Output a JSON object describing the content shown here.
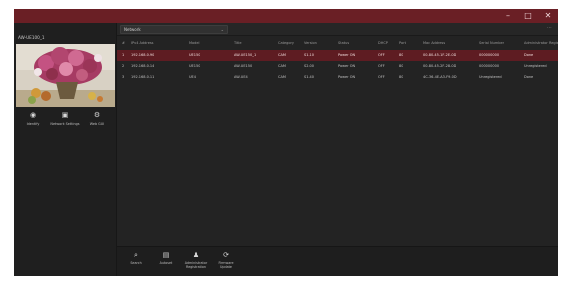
{
  "window": {
    "controls": {
      "minimize": "–",
      "maximize": "□",
      "close": "✕"
    }
  },
  "left_panel": {
    "device_name": "AW-UE100_1",
    "thumbnail": "flowers-camera-preview",
    "buttons": [
      {
        "label": "Identify",
        "icon": "identify-icon",
        "glyph": "◉"
      },
      {
        "label": "Network Settings",
        "icon": "network-settings-icon",
        "glyph": "▣"
      },
      {
        "label": "Web GUI",
        "icon": "web-gui-icon",
        "glyph": "⚙"
      }
    ]
  },
  "topbar": {
    "network_value": "Network",
    "chevron": "⌄",
    "more": "⋯"
  },
  "table": {
    "columns": [
      "#",
      "IPv4 Address",
      "Model",
      "Title",
      "Category",
      "Version",
      "Status",
      "DHCP",
      "Port",
      "Mac Address",
      "Serial Number",
      "Administrator Registration"
    ],
    "rows": [
      [
        "1",
        "192.168.0.90",
        "UE150",
        "AW-UE150_1",
        "CAM",
        "S1.10",
        "Power ON",
        "OFF",
        "80",
        "00-80-45-1F-2E-0D",
        "000000000",
        "Done"
      ],
      [
        "2",
        "192.168.0.14",
        "UE150",
        "AW-UE150",
        "CAM",
        "S2.00",
        "Power ON",
        "OFF",
        "80",
        "00-80-45-2F-28-0D",
        "000000000",
        "Unregistered"
      ],
      [
        "3",
        "192.168.0.11",
        "UE4",
        "AW-UE4",
        "CAM",
        "S1.40",
        "Power ON",
        "OFF",
        "80",
        "4C-36-4E-A3-F9-0D",
        "Unregistered",
        "Done"
      ]
    ]
  },
  "bottom_bar": {
    "buttons": [
      {
        "label": "Search",
        "icon": "search-icon",
        "glyph": "⌕"
      },
      {
        "label": "Autoset",
        "icon": "autoset-icon",
        "glyph": "▤"
      },
      {
        "label": "Administrator Registration",
        "icon": "administrator-icon",
        "glyph": "♟"
      },
      {
        "label": "Firmware Update",
        "icon": "firmware-update-icon",
        "glyph": "⟳"
      }
    ]
  }
}
